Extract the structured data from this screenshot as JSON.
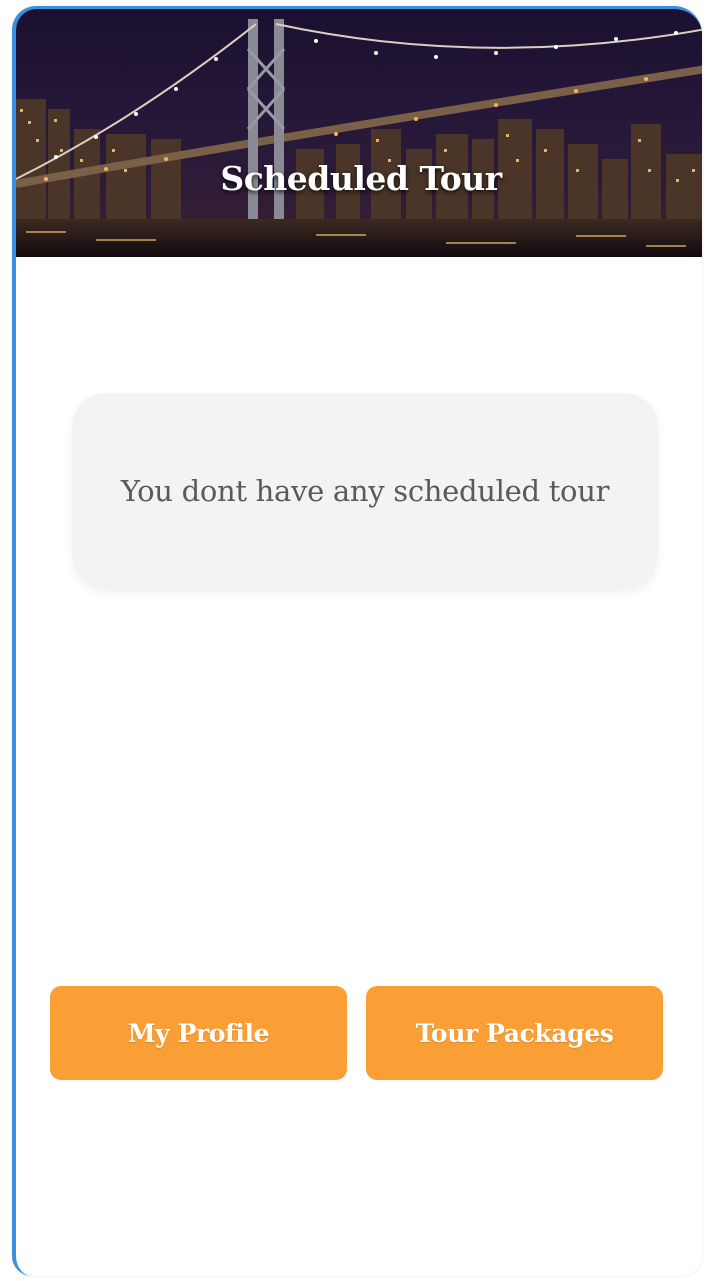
{
  "header": {
    "title": "Scheduled Tour",
    "background_image": "night-city-bridge-skyline"
  },
  "main": {
    "empty_message": "You dont have any scheduled tour"
  },
  "actions": {
    "profile_label": "My Profile",
    "packages_label": "Tour Packages"
  },
  "colors": {
    "accent": "#f99f35",
    "frame_border": "#3a8fde",
    "card_bg": "#f3f3f3",
    "message_text": "#5a5a5a"
  }
}
